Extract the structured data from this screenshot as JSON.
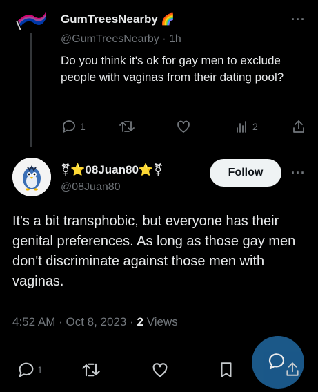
{
  "parent_tweet": {
    "display_name": "GumTreesNearby",
    "name_emoji": "🌈",
    "handle": "@GumTreesNearby",
    "separator": "·",
    "time": "1h",
    "text": "Do you think it's ok for gay men to exclude people with vaginas from their dating pool?",
    "reply_count": "1",
    "retweet_count": "",
    "like_count": "",
    "view_count": "2"
  },
  "main_tweet": {
    "display_name": "⚧⭐08Juan80⭐⚧",
    "handle": "@08Juan80",
    "follow_label": "Follow",
    "text": "It's a bit transphobic, but everyone has their genital preferences. As long as those gay men don't discriminate against those men with vaginas.",
    "timestamp": "4:52 AM · Oct 8, 2023 · ",
    "views_count": "2",
    "views_label": " Views",
    "reply_count": "1"
  },
  "colors": {
    "background": "#000000",
    "text_primary": "#e7e9ea",
    "text_secondary": "#71767b",
    "follow_bg": "#eff3f4",
    "fab": "#1d5f94"
  },
  "icons": [
    "reply-icon",
    "retweet-icon",
    "like-icon",
    "views-icon",
    "share-icon",
    "more-icon",
    "bookmark-icon",
    "compose-icon"
  ]
}
